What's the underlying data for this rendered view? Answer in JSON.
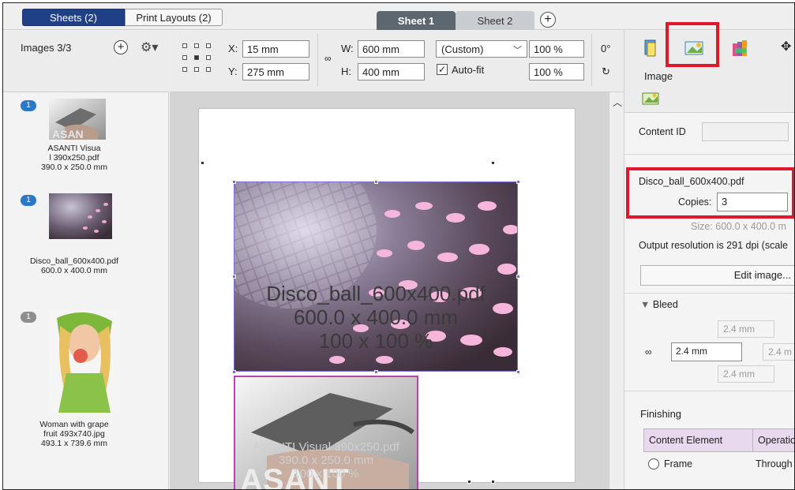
{
  "top_tabs": {
    "sheets": "Sheets (2)",
    "print_layouts": "Print Layouts (2)"
  },
  "sheet_tabs": [
    "Sheet 1",
    "Sheet 2"
  ],
  "add_tab_symbol": "+",
  "left_panel": {
    "title": "Images 3/3",
    "add_symbol": "+",
    "gear_symbol": "⚙▾",
    "items": [
      {
        "badge": "1",
        "caption": [
          "ASANTI Visua",
          "l 390x250.pdf",
          "390.0 x 250.0 mm"
        ]
      },
      {
        "badge": "1",
        "caption": [
          "Disco_ball_600x400.pdf",
          "600.0 x 400.0 mm"
        ]
      },
      {
        "badge": "1",
        "caption": [
          "Woman with grape",
          "fruit 493x740.jpg",
          "493.1 x 739.6 mm"
        ]
      }
    ]
  },
  "toolbar": {
    "x_label": "X:",
    "x_value": "15 mm",
    "y_label": "Y:",
    "y_value": "275 mm",
    "w_label": "W:",
    "w_value": "600 mm",
    "h_label": "H:",
    "h_value": "400 mm",
    "size_preset": "(Custom)",
    "scale_w": "100 %",
    "scale_h": "100 %",
    "autofit_label": "Auto-fit",
    "rotation": "0°"
  },
  "canvas": {
    "image1_overlay": [
      "Disco_ball_600x400.pdf",
      "600.0 x 400.0 mm",
      "100 x 100 %"
    ],
    "image2_overlay": [
      "ASANTI Visual 390x250.pdf",
      "390.0 x 250.0 mm",
      "100 x 100 %"
    ]
  },
  "right_panel": {
    "section_label": "Image",
    "content_id_label": "Content ID",
    "file_name": "Disco_ball_600x400.pdf",
    "copies_label": "Copies:",
    "copies_value": "3",
    "size_text": "Size:  600.0 x 400.0 m",
    "output_resolution": "Output resolution is 291 dpi (scale",
    "edit_image_button": "Edit image...",
    "bleed_label": "Bleed",
    "bleed_top": "2.4 mm",
    "bleed_left": "2.4 mm",
    "bleed_right": "2.4 m",
    "bleed_bottom": "2.4 mm",
    "finishing_label": "Finishing",
    "table_headers": [
      "Content Element",
      "Operatio"
    ],
    "table_row": {
      "element": "Frame",
      "operation": "Through"
    }
  },
  "colors": {
    "accent": "#1f3f86",
    "highlight_red": "#e0182a",
    "selection": "#7b6fd0"
  }
}
